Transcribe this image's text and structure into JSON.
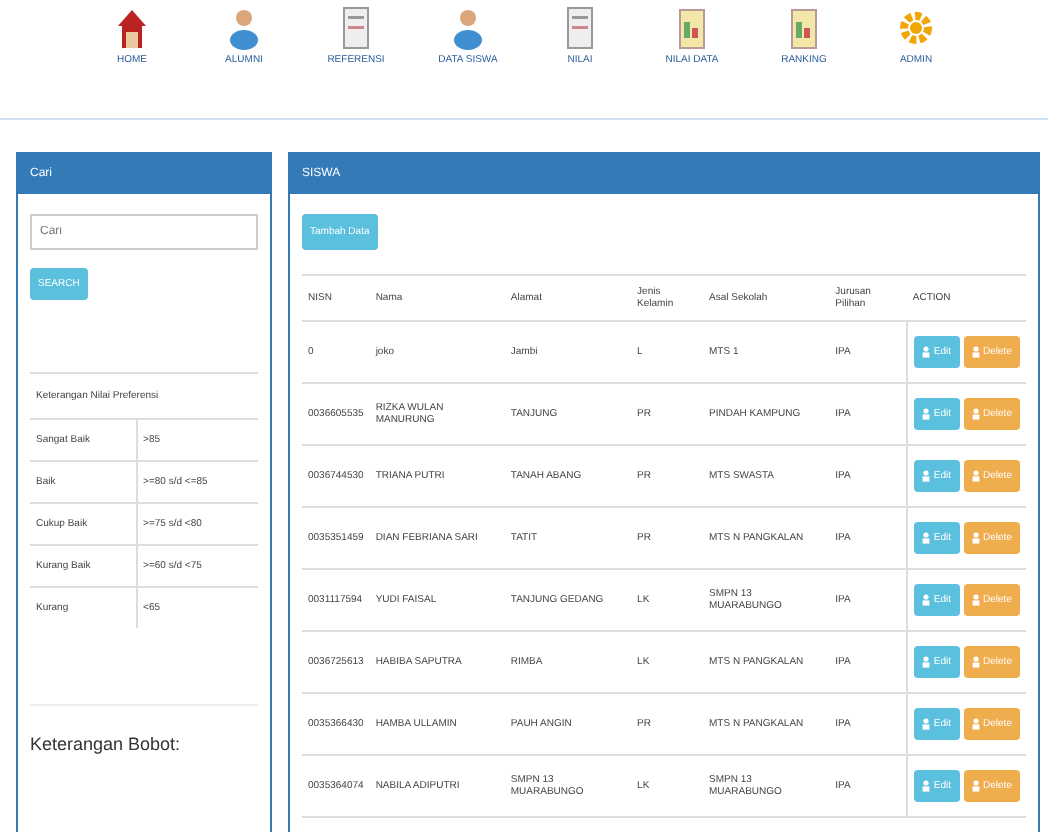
{
  "nav": [
    {
      "label": "HOME",
      "kind": "house"
    },
    {
      "label": "ALUMNI",
      "kind": "person"
    },
    {
      "label": "REFERENSI",
      "kind": "document"
    },
    {
      "label": "DATA SISWA",
      "kind": "person"
    },
    {
      "label": "NILAI",
      "kind": "document"
    },
    {
      "label": "NILAI DATA",
      "kind": "chart"
    },
    {
      "label": "RANKING",
      "kind": "chart"
    },
    {
      "label": "ADMIN",
      "kind": "gear"
    }
  ],
  "search_panel": {
    "title": "Cari",
    "placeholder": "Cari",
    "button": "SEARCH",
    "legend": {
      "title": "Keterangan Nilai Preferensi",
      "rows": [
        [
          "Sangat Baik",
          ">85"
        ],
        [
          "Baik",
          ">=80 s/d <=85"
        ],
        [
          "Cukup Baik",
          ">=75 s/d <80"
        ],
        [
          "Kurang Baik",
          ">=60 s/d <75"
        ],
        [
          "Kurang",
          "<65"
        ]
      ]
    },
    "footer": "Keterangan Bobot:"
  },
  "students_panel": {
    "title": "SISWA",
    "add_button": "Tambah Data",
    "columns": [
      "NISN",
      "Nama",
      "Alamat",
      "Jenis Kelamin",
      "Asal Sekolah",
      "Jurusan Pilihan",
      "ACTION"
    ],
    "rows": [
      {
        "cells": [
          "0",
          "joko",
          "Jambi",
          "L",
          "MTS 1",
          "IPA"
        ],
        "edit": "Edit",
        "delete": "Delete"
      },
      {
        "cells": [
          "0036605535",
          "RIZKA WULAN MANURUNG",
          "TANJUNG",
          "PR",
          "PINDAH KAMPUNG",
          "IPA"
        ],
        "edit": "Edit",
        "delete": "Delete"
      },
      {
        "cells": [
          "0036744530",
          "TRIANA PUTRI",
          "TANAH ABANG",
          "PR",
          "MTS SWASTA",
          "IPA"
        ],
        "edit": "Edit",
        "delete": "Delete"
      },
      {
        "cells": [
          "0035351459",
          "DIAN FEBRIANA SARI",
          "TATIT",
          "PR",
          "MTS N PANGKALAN",
          "IPA"
        ],
        "edit": "Edit",
        "delete": "Delete"
      },
      {
        "cells": [
          "0031117594",
          "YUDI FAISAL",
          "TANJUNG GEDANG",
          "LK",
          "SMPN 13 MUARABUNGO",
          "IPA"
        ],
        "edit": "Edit",
        "delete": "Delete"
      },
      {
        "cells": [
          "0036725613",
          "HABIBA SAPUTRA",
          "RIMBA",
          "LK",
          "MTS N PANGKALAN",
          "IPA"
        ],
        "edit": "Edit",
        "delete": "Delete"
      },
      {
        "cells": [
          "0035366430",
          "HAMBA ULLAMIN",
          "PAUH ANGIN",
          "PR",
          "MTS N PANGKALAN",
          "IPA"
        ],
        "edit": "Edit",
        "delete": "Delete"
      },
      {
        "cells": [
          "0035364074",
          "NABILA ADIPUTRI",
          "SMPN 13 MUARABUNGO",
          "LK",
          "SMPN 13 MUARABUNGO",
          "IPA"
        ],
        "edit": "Edit",
        "delete": "Delete"
      }
    ]
  }
}
